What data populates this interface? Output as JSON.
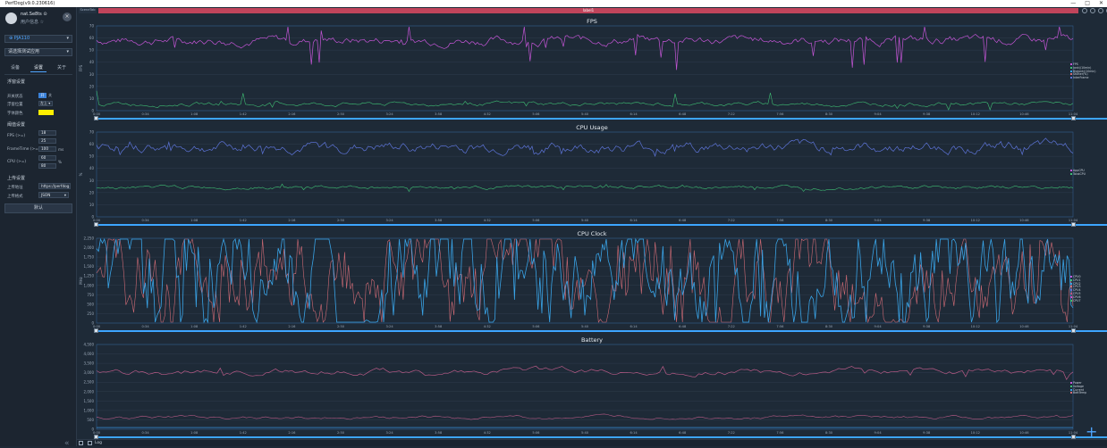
{
  "window": {
    "title": "PerfDog(v9.0.230616)",
    "buttons": [
      "—",
      "□",
      "✕"
    ]
  },
  "sidebar": {
    "user_name": "nat.Se8ts ⊙",
    "user_status": "用户信息 ☆",
    "device": "⊕ PJA110",
    "app_placeholder": "请选择测试应用",
    "tabs": [
      "设备",
      "设置",
      "关于"
    ],
    "active_tab": 1,
    "floating_section": "浮窗设置",
    "float_switch_label": "开关状态",
    "float_on": "开",
    "float_off": "关",
    "float_pos_label": "浮窗位置",
    "float_pos_value": "左上",
    "float_color_label": "字体颜色",
    "float_color": "#ffee00",
    "threshold_section": "阈值设置",
    "fps_label": "FPS (>=)",
    "fps_values": [
      "18",
      "25"
    ],
    "frametime_label": "FrameTime (>=)",
    "frametime_value": "100",
    "frametime_unit": "ms",
    "cpu_label": "CPU (>=)",
    "cpu_values": [
      "60",
      "80"
    ],
    "cpu_unit": "%",
    "upload_section": "上传设置",
    "upload_addr_label": "上传地址",
    "upload_addr_value": "https://perfdog.q",
    "upload_format_label": "上传格式",
    "upload_format_value": "JSON",
    "reset_label": "默认",
    "collapse_icon": "«"
  },
  "main": {
    "scene_tab": "SceneTab",
    "label_bar": "label1",
    "log_label": "Log",
    "plus_icon": "+"
  },
  "x_ticks": [
    "0:00",
    "0:34",
    "1:08",
    "1:42",
    "2:16",
    "2:50",
    "3:24",
    "3:58",
    "4:32",
    "5:06",
    "5:40",
    "6:14",
    "6:48",
    "7:22",
    "7:56",
    "8:30",
    "9:04",
    "9:38",
    "10:12",
    "10:46",
    "11:04"
  ],
  "charts": {
    "fps": {
      "title": "FPS",
      "ylabel": "FPS",
      "y_ticks": [
        "0",
        "10",
        "20",
        "30",
        "40",
        "50",
        "60",
        "70"
      ],
      "legend": [
        "FPS",
        "Jank(/10min)",
        "BigJank(/10min)",
        "Stutter(%)",
        "InterFrame"
      ]
    },
    "cpu": {
      "title": "CPU Usage",
      "ylabel": "%",
      "y_ticks": [
        "0",
        "10",
        "20",
        "30",
        "40",
        "50",
        "60",
        "70"
      ],
      "legend": [
        "AppCPU",
        "TotalCPU"
      ]
    },
    "clock": {
      "title": "CPU Clock",
      "ylabel": "MHz",
      "y_ticks": [
        "0",
        "250",
        "500",
        "750",
        "1,000",
        "1,250",
        "1,500",
        "1,750",
        "2,000",
        "2,250"
      ],
      "legend": [
        "CPU0",
        "CPU1",
        "CPU2",
        "CPU3",
        "CPU4",
        "CPU5",
        "CPU6",
        "CPU7"
      ]
    },
    "battery": {
      "title": "Battery",
      "ylabel": "",
      "y_ticks": [
        "0",
        "500",
        "1,000",
        "1,500",
        "2,000",
        "2,500",
        "3,000",
        "3,500",
        "4,000",
        "4,500"
      ],
      "legend": [
        "Power",
        "Voltage",
        "Current",
        "BattTemp"
      ]
    }
  },
  "colors": {
    "fps_line": "#c455d6",
    "green": "#3fbf74",
    "cpu_total": "#5d74d8",
    "clock_blue": "#39a3e6",
    "clock_red": "#d06b75",
    "battery_line": "#b75a86",
    "accent": "#3da5ff",
    "label_bar": "#c0445b"
  }
}
